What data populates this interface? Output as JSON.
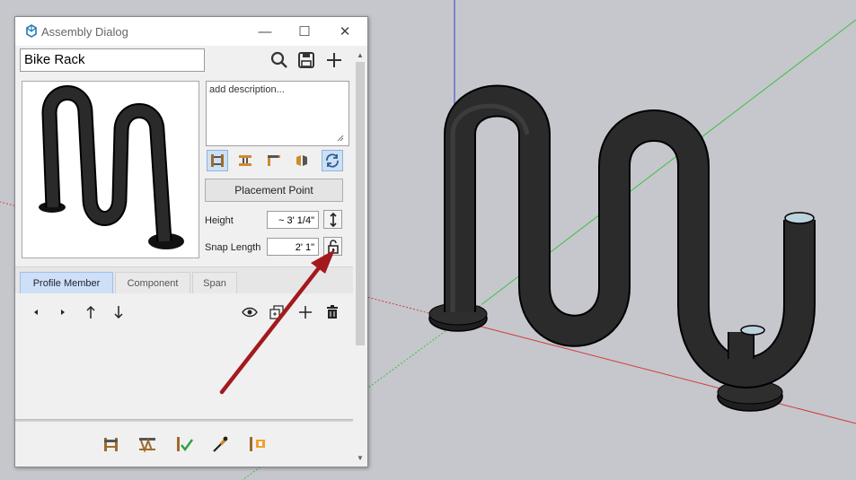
{
  "window": {
    "title": "Assembly Dialog",
    "minimize_glyph": "—",
    "maximize_glyph": "☐",
    "close_glyph": "✕"
  },
  "assembly": {
    "name": "Bike Rack",
    "description_placeholder": "add description..."
  },
  "toolbar_icons": [
    "search-icon",
    "save-icon",
    "add-icon"
  ],
  "placement_button_label": "Placement Point",
  "height": {
    "label": "Height",
    "value": "~ 3' 1/4\""
  },
  "snap_length": {
    "label": "Snap Length",
    "value": "2' 1\""
  },
  "tabs": [
    {
      "label": "Profile Member",
      "active": true
    },
    {
      "label": "Component",
      "active": false
    },
    {
      "label": "Span",
      "active": false
    }
  ],
  "colors": {
    "accent": "#cde0f7",
    "arrow": "#a3191e",
    "axis_red": "#d33b3b",
    "axis_green": "#3fbf3f",
    "axis_blue": "#3c3cd8",
    "rack": "#2b2b2b",
    "background": "#c5c7cd"
  }
}
